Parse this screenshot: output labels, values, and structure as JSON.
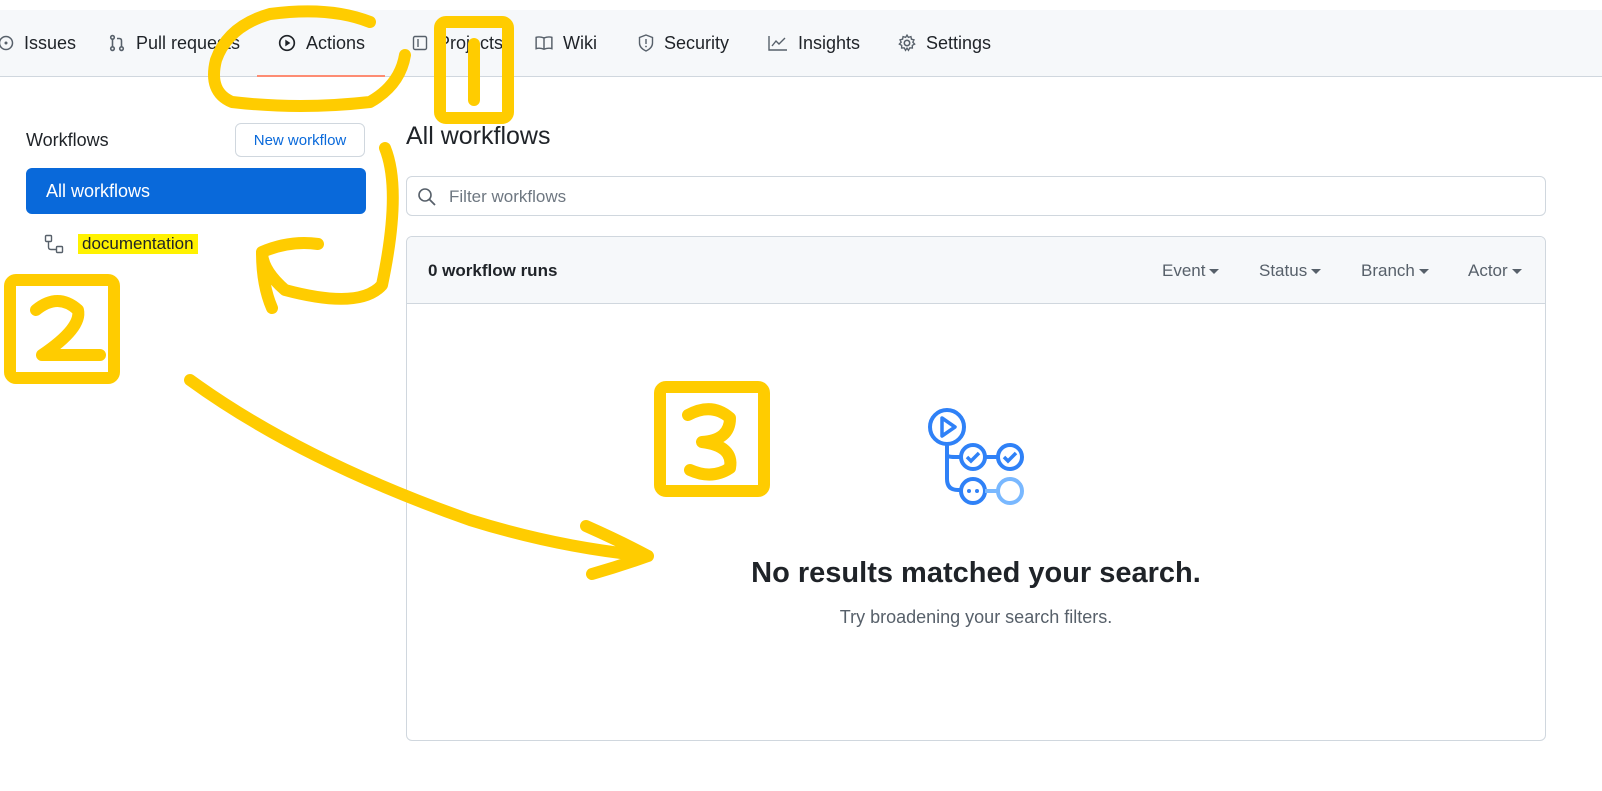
{
  "nav": {
    "tabs": [
      {
        "label": "Issues",
        "icon": "issue-icon"
      },
      {
        "label": "Pull requests",
        "icon": "pull-request-icon"
      },
      {
        "label": "Actions",
        "icon": "play-icon",
        "active": true
      },
      {
        "label": "Projects",
        "icon": "project-icon"
      },
      {
        "label": "Wiki",
        "icon": "book-icon"
      },
      {
        "label": "Security",
        "icon": "shield-icon"
      },
      {
        "label": "Insights",
        "icon": "graph-icon"
      },
      {
        "label": "Settings",
        "icon": "gear-icon"
      }
    ]
  },
  "sidebar": {
    "title": "Workflows",
    "new_workflow": "New workflow",
    "items": [
      {
        "label": "All workflows",
        "selected": true
      },
      {
        "label": "documentation",
        "icon": "workflow-icon",
        "highlighted": true
      }
    ]
  },
  "main": {
    "title": "All workflows",
    "filter_placeholder": "Filter workflows",
    "runs_count": "0 workflow runs",
    "filters": [
      "Event",
      "Status",
      "Branch",
      "Actor"
    ],
    "empty_title": "No results matched your search.",
    "empty_subtitle": "Try broadening your search filters."
  },
  "annotations": {
    "marker_1": "1",
    "marker_2": "2",
    "marker_3": "3",
    "color": "#ffcc00"
  },
  "colors": {
    "accent": "#0969da",
    "tab_underline": "#fd8c73",
    "highlight": "#fff200"
  }
}
